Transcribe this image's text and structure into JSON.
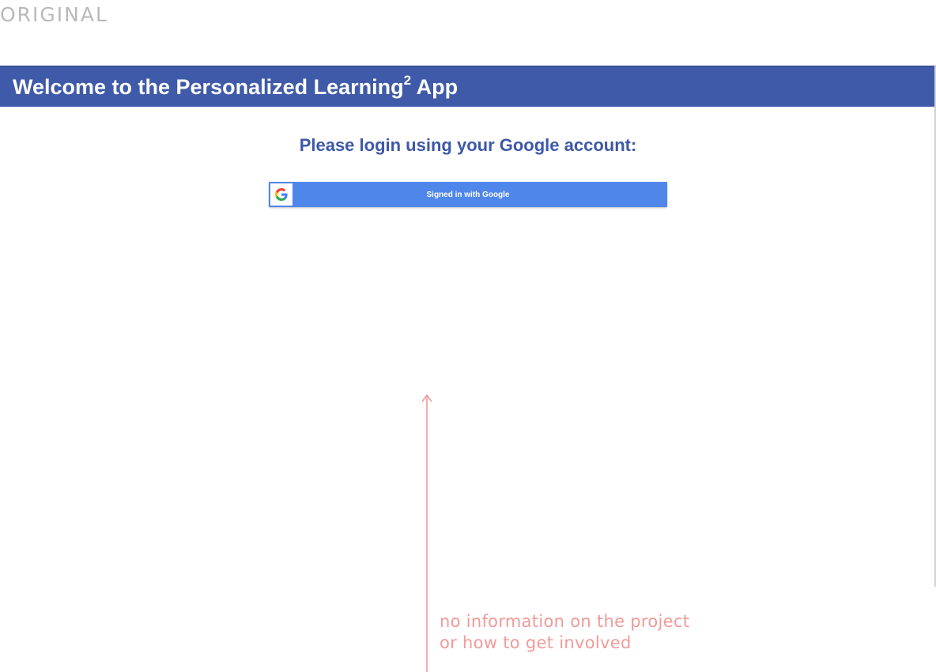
{
  "tag_label": "ORIGINAL",
  "header": {
    "title": "Welcome to the Personalized Learning",
    "superscript": "2",
    "title_suffix": " App"
  },
  "main": {
    "login_heading": "Please login using your Google account:",
    "google_button_label": "Signed in with Google",
    "google_icon": "google-g-icon"
  },
  "annotation": {
    "line1": "no information on the project",
    "line2": "or how to get involved"
  },
  "colors": {
    "header_bg": "#3f5aa8",
    "heading_text": "#3d58a8",
    "google_button_bg": "#4f86ea",
    "annotation": "#f29a98",
    "tag_label": "#b9b9b9"
  }
}
